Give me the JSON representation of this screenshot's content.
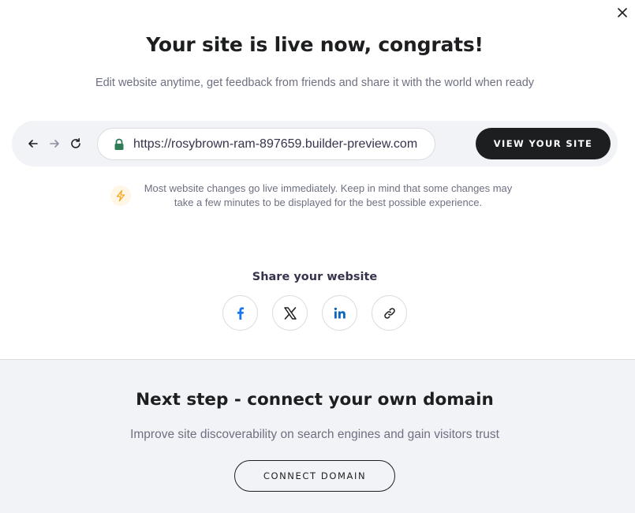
{
  "modal": {
    "close_icon": "close-icon",
    "title": "Your site is live now, congrats!",
    "subtitle": "Edit website anytime, get feedback from friends and share it with the world when ready"
  },
  "browser": {
    "back_icon": "arrow-left-icon",
    "forward_icon": "arrow-right-icon",
    "reload_icon": "reload-icon",
    "lock_icon": "lock-icon",
    "url": "https://rosybrown-ram-897659.builder-preview.com",
    "view_button": "VIEW YOUR SITE"
  },
  "info": {
    "icon": "lightning-icon",
    "text": "Most website changes go live immediately. Keep in mind that some changes may take a few minutes to be displayed for the best possible experience."
  },
  "share": {
    "title": "Share your website",
    "buttons": [
      {
        "icon": "facebook-icon"
      },
      {
        "icon": "x-icon"
      },
      {
        "icon": "linkedin-icon"
      },
      {
        "icon": "link-icon"
      }
    ]
  },
  "next_step": {
    "title": "Next step - connect your own domain",
    "subtitle": "Improve site discoverability on search engines and gain visitors trust",
    "button": "CONNECT DOMAIN"
  },
  "colors": {
    "primary_dark": "#1d1e20",
    "text_muted": "#6d7081",
    "panel_bg": "#f2f3f6",
    "lock_green": "#2e7d57",
    "facebook_blue": "#1877f2",
    "linkedin_blue": "#0a66c2",
    "bolt_orange": "#f5a623"
  }
}
